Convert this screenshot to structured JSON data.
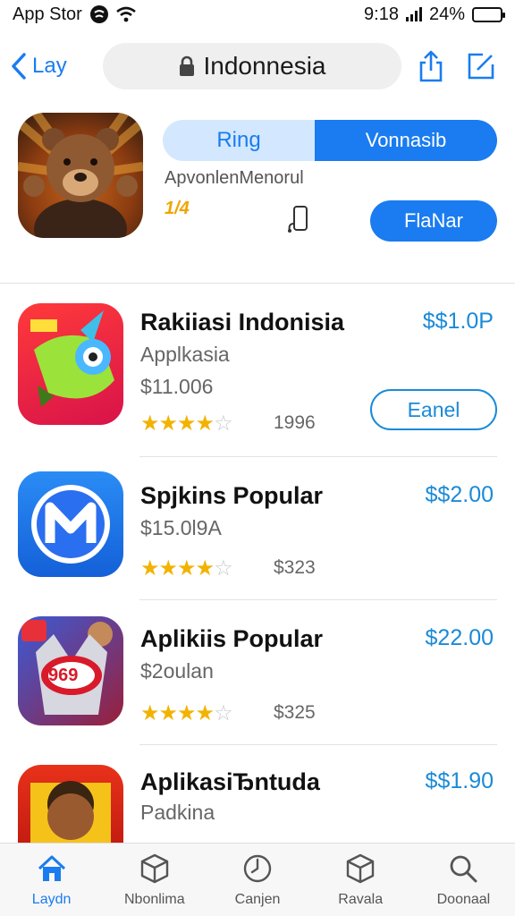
{
  "status": {
    "carrier": "App Stor",
    "time": "9:18",
    "battery": "24%",
    "battery_level": 0.24
  },
  "nav": {
    "back_label": "Lay",
    "search_text": "Indonnesia"
  },
  "featured": {
    "segment_left": "Ring",
    "segment_right": "Vonnasib",
    "subtitle": "ApvonlenMenorul",
    "rating_text": "1/4",
    "button": "FlaNar"
  },
  "apps": [
    {
      "title": "Rakiiasi Indonisia",
      "price": "$$1.0P",
      "subtitle": "Applkasia",
      "subtitle2": "$11.006",
      "rating": 4.5,
      "count": "1996",
      "button": "Eanel"
    },
    {
      "title": "Spjkins Popular",
      "price": "$$2.00",
      "subtitle": "$15.0l9A",
      "rating": 4.5,
      "count": "$323"
    },
    {
      "title": "Aplikiis Popular",
      "price": "$22.00",
      "subtitle": "$2oulan",
      "rating": 4.5,
      "count": "$325"
    },
    {
      "title": "AplikasiЂntuda",
      "price": "$$1.90",
      "subtitle": "Padkina"
    }
  ],
  "app4_badge": "969",
  "tabs": [
    {
      "label": "Laydn",
      "icon": "home-icon",
      "active": true
    },
    {
      "label": "Nbonlima",
      "icon": "box-icon",
      "active": false
    },
    {
      "label": "Canjen",
      "icon": "clock-icon",
      "active": false
    },
    {
      "label": "Ravala",
      "icon": "box-icon",
      "active": false
    },
    {
      "label": "Doonaal",
      "icon": "search-icon",
      "active": false
    }
  ],
  "colors": {
    "accent": "#1a7cf0",
    "price": "#1a8ad8",
    "star": "#f2b300"
  }
}
